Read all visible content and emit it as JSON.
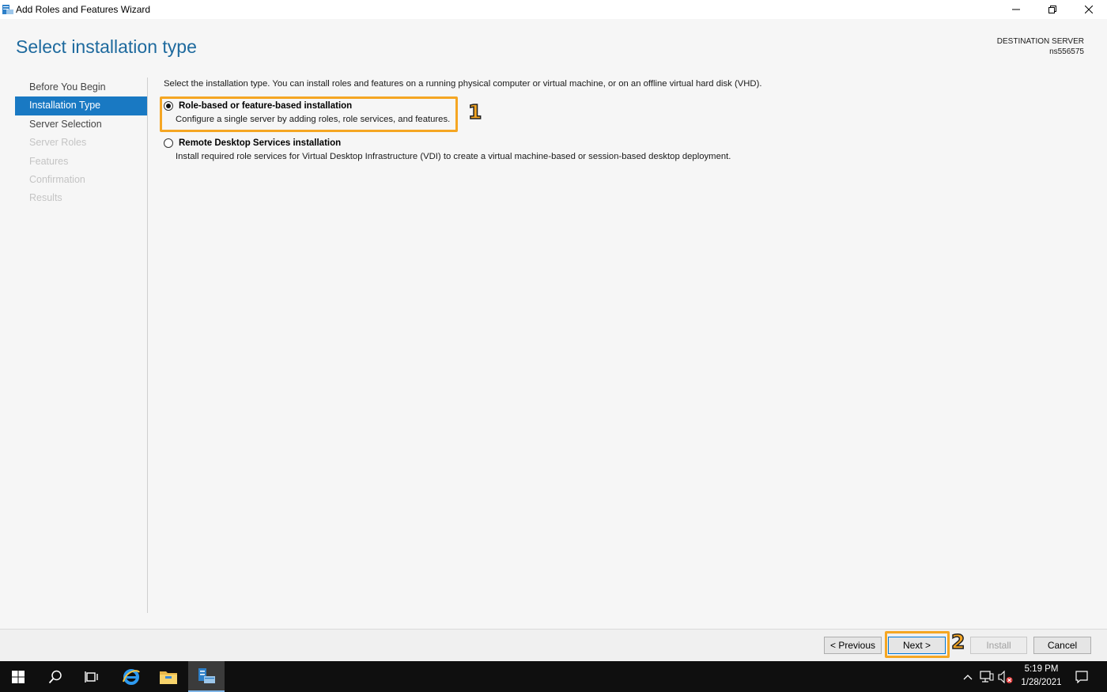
{
  "window": {
    "title": "Add Roles and Features Wizard",
    "minimize": "minimize",
    "restore": "restore",
    "close": "close"
  },
  "page": {
    "title": "Select installation type",
    "destination_label": "DESTINATION SERVER",
    "destination_value": "ns556575"
  },
  "nav": {
    "items": [
      {
        "label": "Before You Begin",
        "state": "normal"
      },
      {
        "label": "Installation Type",
        "state": "active"
      },
      {
        "label": "Server Selection",
        "state": "normal"
      },
      {
        "label": "Server Roles",
        "state": "disabled"
      },
      {
        "label": "Features",
        "state": "disabled"
      },
      {
        "label": "Confirmation",
        "state": "disabled"
      },
      {
        "label": "Results",
        "state": "disabled"
      }
    ]
  },
  "main": {
    "intro": "Select the installation type. You can install roles and features on a running physical computer or virtual machine, or on an offline virtual hard disk (VHD).",
    "options": [
      {
        "title": "Role-based or feature-based installation",
        "description": "Configure a single server by adding roles, role services, and features.",
        "selected": true
      },
      {
        "title": "Remote Desktop Services installation",
        "description": "Install required role services for Virtual Desktop Infrastructure (VDI) to create a virtual machine-based or session-based desktop deployment.",
        "selected": false
      }
    ]
  },
  "annotations": {
    "step1": "1",
    "step2": "2",
    "color": "#f5a623"
  },
  "footer": {
    "previous": "< Previous",
    "next": "Next >",
    "install": "Install",
    "cancel": "Cancel"
  },
  "taskbar": {
    "icons": [
      "windows-start-icon",
      "search-icon",
      "task-view-icon",
      "internet-explorer-icon",
      "file-explorer-icon",
      "server-manager-icon"
    ],
    "time": "5:19 PM",
    "date": "1/28/2021"
  },
  "colors": {
    "accent": "#1979c3",
    "title": "#1e6a9e"
  }
}
